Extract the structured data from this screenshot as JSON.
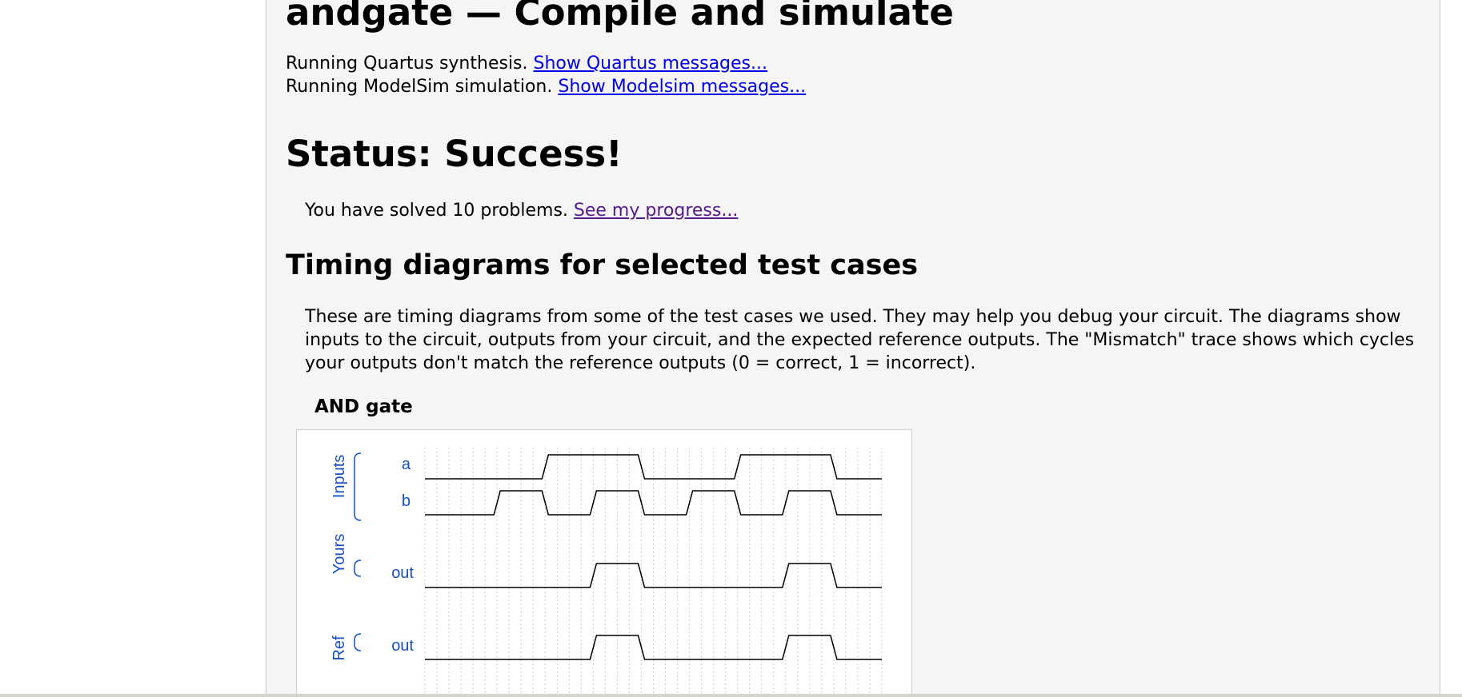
{
  "page": {
    "title": "andgate — Compile and simulate",
    "quartus_text": "Running Quartus synthesis.",
    "quartus_link": "Show Quartus messages...",
    "modelsim_text": "Running ModelSim simulation.",
    "modelsim_link": "Show Modelsim messages...",
    "status": "Status: Success!",
    "solved_text": "You have solved 10 problems.",
    "progress_link": "See my progress...",
    "timing_heading": "Timing diagrams for selected test cases",
    "timing_description": "These are timing diagrams from some of the test cases we used. They may help you debug your circuit. The diagrams show inputs to the circuit, outputs from your circuit, and the expected reference outputs. The \"Mismatch\" trace shows which cycles your outputs don't match the reference outputs (0 = correct, 1 = incorrect)."
  },
  "diagram": {
    "title": "AND gate",
    "groups": [
      {
        "label": "Inputs",
        "signals": [
          {
            "name": "a",
            "levels": [
              0,
              0,
              0,
              0,
              0,
              1,
              1,
              1,
              1,
              0,
              0,
              0,
              0,
              1,
              1,
              1,
              1,
              0,
              0
            ]
          },
          {
            "name": "b",
            "levels": [
              0,
              0,
              0,
              1,
              1,
              0,
              0,
              1,
              1,
              0,
              0,
              1,
              1,
              0,
              0,
              1,
              1,
              0,
              0
            ]
          }
        ]
      },
      {
        "label": "Yours",
        "signals": [
          {
            "name": "out",
            "levels": [
              0,
              0,
              0,
              0,
              0,
              0,
              0,
              1,
              1,
              0,
              0,
              0,
              0,
              0,
              0,
              1,
              1,
              0,
              0
            ]
          }
        ]
      },
      {
        "label": "Ref",
        "signals": [
          {
            "name": "out",
            "levels": [
              0,
              0,
              0,
              0,
              0,
              0,
              0,
              1,
              1,
              0,
              0,
              0,
              0,
              0,
              0,
              1,
              1,
              0,
              0
            ]
          }
        ]
      }
    ],
    "colors": {
      "label": "#1850c0",
      "trace": "#000000",
      "grid": "#cccccc"
    }
  }
}
